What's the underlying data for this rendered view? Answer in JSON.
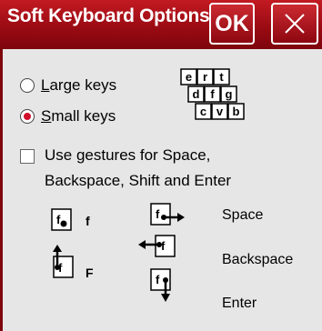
{
  "title": "Soft Keyboard Options",
  "buttons": {
    "ok": "OK"
  },
  "options": {
    "large_keys": "Large keys",
    "small_keys": "Small keys",
    "selected": "Small keys"
  },
  "key_preview": [
    "e",
    "r",
    "t",
    "d",
    "f",
    "g",
    "c",
    "v",
    "b"
  ],
  "gestures": {
    "checkbox_label_line1": "Use gestures for Space,",
    "checkbox_label_line2": "Backspace, Shift and Enter",
    "checked": false,
    "examples": {
      "tap_key": "f",
      "tap_result": "f",
      "shift_result": "F",
      "space": "Space",
      "backspace": "Backspace",
      "enter": "Enter"
    }
  }
}
